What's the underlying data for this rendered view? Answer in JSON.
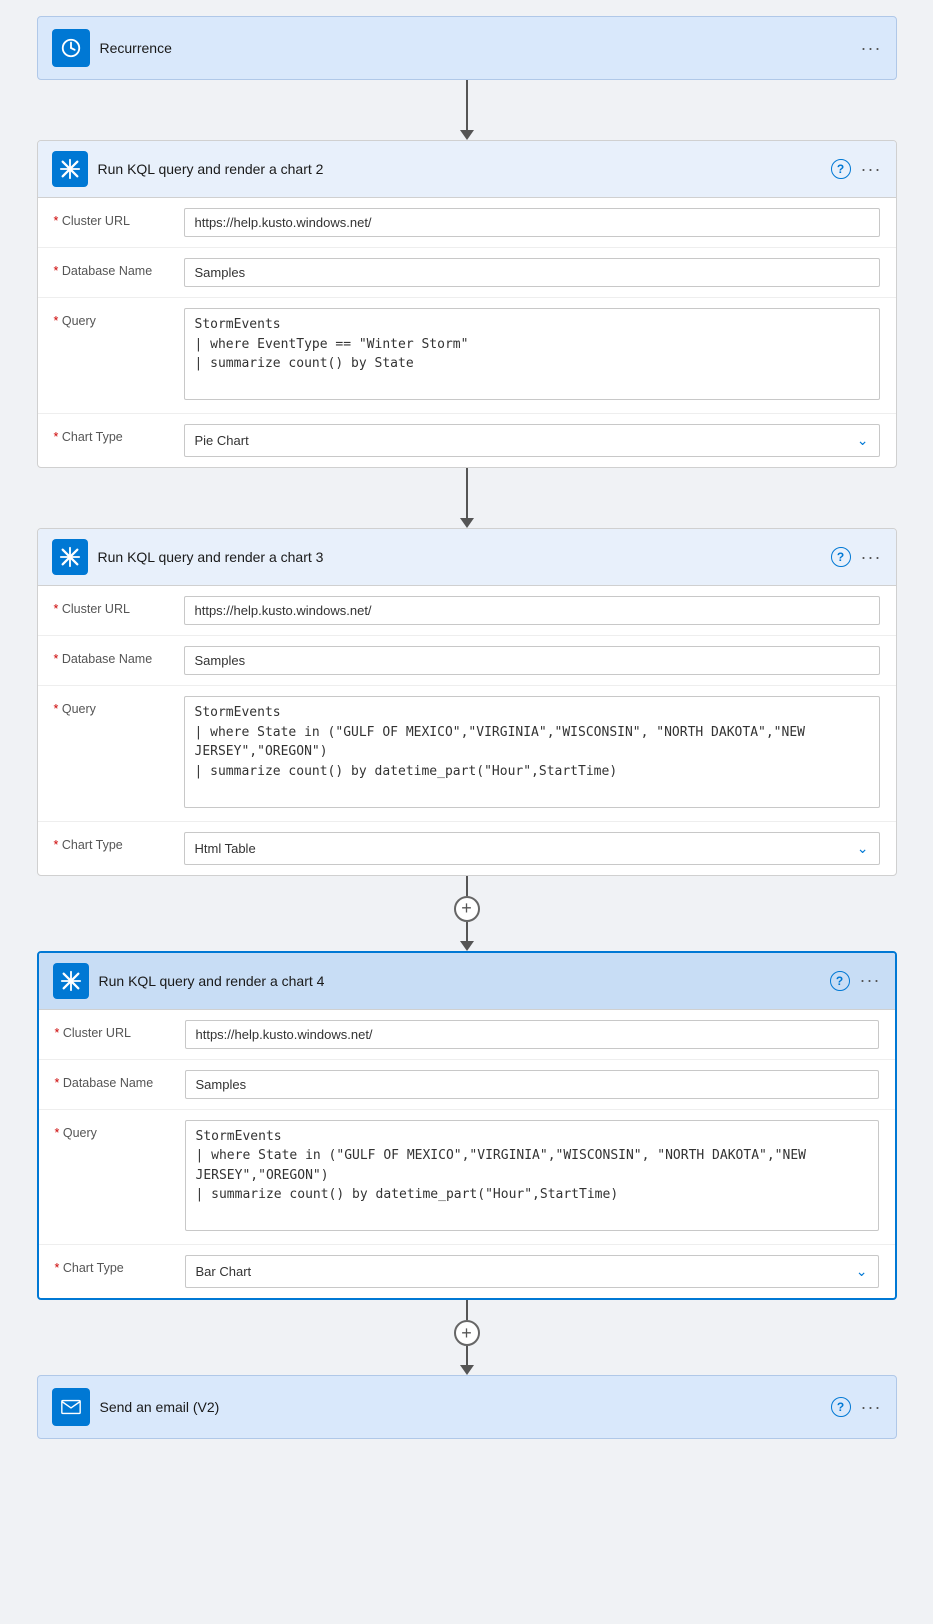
{
  "recurrence": {
    "title": "Recurrence",
    "icon": "clock"
  },
  "card2": {
    "title": "Run KQL query and render a chart 2",
    "fields": {
      "clusterUrl": {
        "label": "* Cluster URL",
        "value": "https://help.kusto.windows.net/"
      },
      "databaseName": {
        "label": "* Database Name",
        "value": "Samples"
      },
      "query": {
        "label": "* Query",
        "value": "StormEvents\n| where EventType == \"Winter Storm\"\n| summarize count() by State"
      },
      "chartType": {
        "label": "* Chart Type",
        "value": "Pie Chart"
      }
    }
  },
  "card3": {
    "title": "Run KQL query and render a chart 3",
    "fields": {
      "clusterUrl": {
        "label": "* Cluster URL",
        "value": "https://help.kusto.windows.net/"
      },
      "databaseName": {
        "label": "* Database Name",
        "value": "Samples"
      },
      "query": {
        "label": "* Query",
        "value": "StormEvents\n| where State in (\"GULF OF MEXICO\",\"VIRGINIA\",\"WISCONSIN\", \"NORTH DAKOTA\",\"NEW JERSEY\",\"OREGON\")\n| summarize count() by datetime_part(\"Hour\",StartTime)"
      },
      "chartType": {
        "label": "* Chart Type",
        "value": "Html Table"
      }
    }
  },
  "card4": {
    "title": "Run KQL query and render a chart 4",
    "fields": {
      "clusterUrl": {
        "label": "* Cluster URL",
        "value": "https://help.kusto.windows.net/"
      },
      "databaseName": {
        "label": "* Database Name",
        "value": "Samples"
      },
      "query": {
        "label": "* Query",
        "value": "StormEvents\n| where State in (\"GULF OF MEXICO\",\"VIRGINIA\",\"WISCONSIN\", \"NORTH DAKOTA\",\"NEW JERSEY\",\"OREGON\")\n| summarize count() by datetime_part(\"Hour\",StartTime)"
      },
      "chartType": {
        "label": "* Chart Type",
        "value": "Bar Chart"
      }
    }
  },
  "emailCard": {
    "title": "Send an email (V2)",
    "icon": "email"
  },
  "ui": {
    "helpLabel": "?",
    "moreLabel": "···",
    "plusLabel": "+",
    "chevronDown": "⌄"
  }
}
